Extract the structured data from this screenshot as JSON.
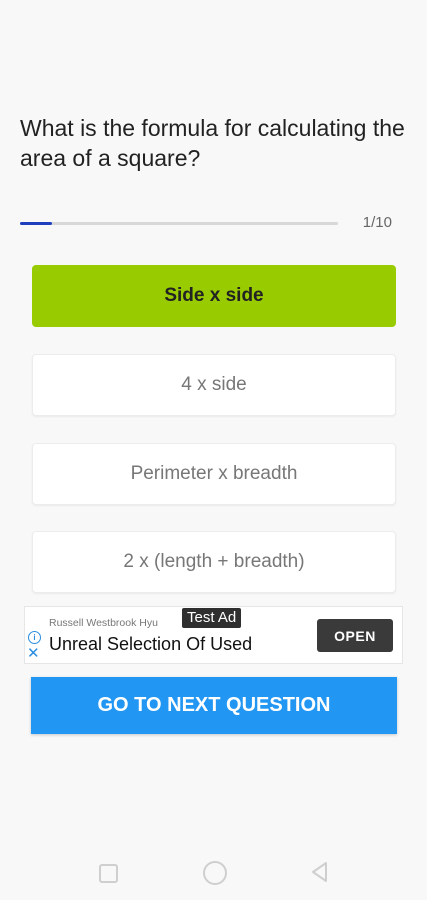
{
  "quiz": {
    "question": "What is the formula for calculating the area of a square?",
    "progress_label": "1/10",
    "progress_fraction": 0.1,
    "options": [
      {
        "label": "Side x side",
        "state": "correct"
      },
      {
        "label": "4 x side",
        "state": "neutral"
      },
      {
        "label": "Perimeter x breadth",
        "state": "neutral"
      },
      {
        "label": "2  x (length + breadth)",
        "state": "neutral"
      }
    ],
    "next_button_label": "GO TO NEXT QUESTION"
  },
  "ad": {
    "sponsor": "Russell Westbrook Hyu",
    "badge": "Test Ad",
    "headline": "Unreal Selection Of Used",
    "cta": "OPEN",
    "info_icon": "info-icon",
    "close_icon": "close-icon"
  },
  "navigation_bar": {
    "buttons": [
      "recent-apps",
      "home",
      "back"
    ]
  },
  "colors": {
    "correct": "#99cc00",
    "primary": "#2196f3",
    "progress": "#1f3fbf"
  }
}
